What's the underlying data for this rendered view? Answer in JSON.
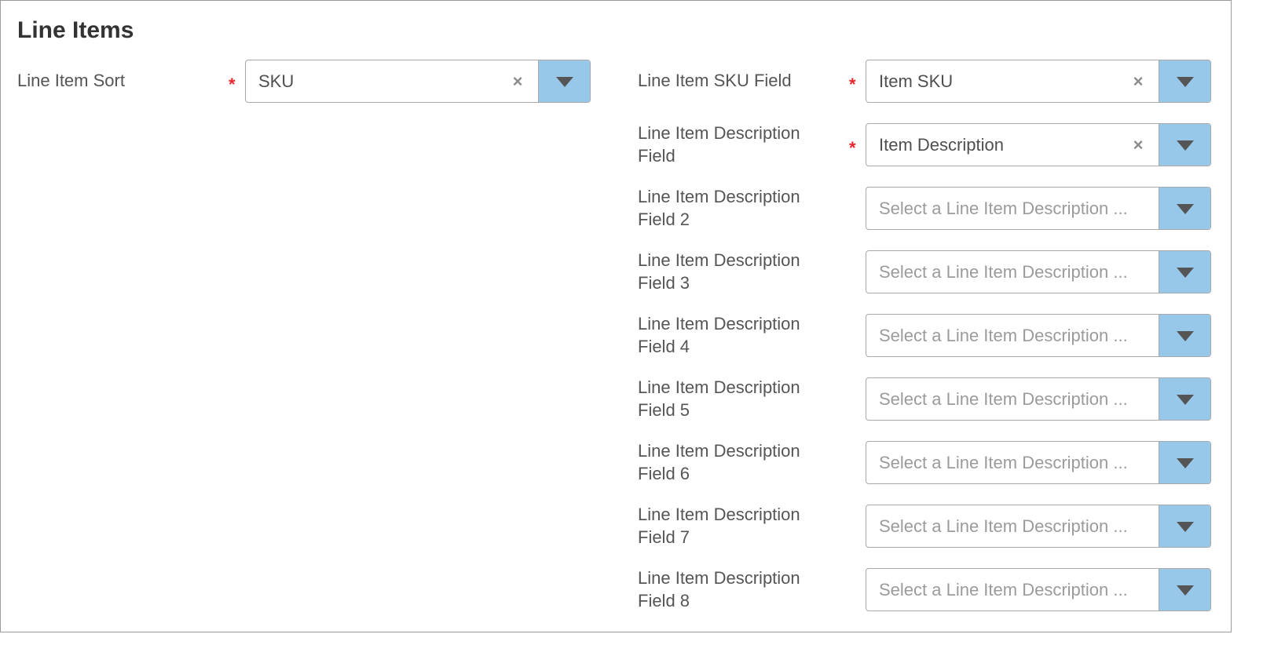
{
  "section": {
    "title": "Line Items"
  },
  "required_marker": "*",
  "clear_glyph": "×",
  "icons": {
    "clear": "clear-x-icon",
    "dropdown": "caret-down-icon"
  },
  "colors": {
    "required": "#e8262b",
    "dropdown_button": "#97c8ea",
    "placeholder": "#9b9b9b"
  },
  "left": {
    "sort": {
      "label": "Line Item Sort",
      "required": true,
      "value": "SKU"
    }
  },
  "right": {
    "sku": {
      "label": "Line Item SKU Field",
      "required": true,
      "value": "Item SKU"
    },
    "desc": {
      "label1": "Line Item Description",
      "label2": "Field",
      "required": true,
      "value": "Item Description"
    },
    "desc2": {
      "label1": "Line Item Description",
      "label2": "Field 2",
      "placeholder": "Select a Line Item Description ..."
    },
    "desc3": {
      "label1": "Line Item Description",
      "label2": "Field 3",
      "placeholder": "Select a Line Item Description ..."
    },
    "desc4": {
      "label1": "Line Item Description",
      "label2": "Field 4",
      "placeholder": "Select a Line Item Description ..."
    },
    "desc5": {
      "label1": "Line Item Description",
      "label2": "Field 5",
      "placeholder": "Select a Line Item Description ..."
    },
    "desc6": {
      "label1": "Line Item Description",
      "label2": "Field 6",
      "placeholder": "Select a Line Item Description ..."
    },
    "desc7": {
      "label1": "Line Item Description",
      "label2": "Field 7",
      "placeholder": "Select a Line Item Description ..."
    },
    "desc8": {
      "label1": "Line Item Description",
      "label2": "Field 8",
      "placeholder": "Select a Line Item Description ..."
    }
  }
}
